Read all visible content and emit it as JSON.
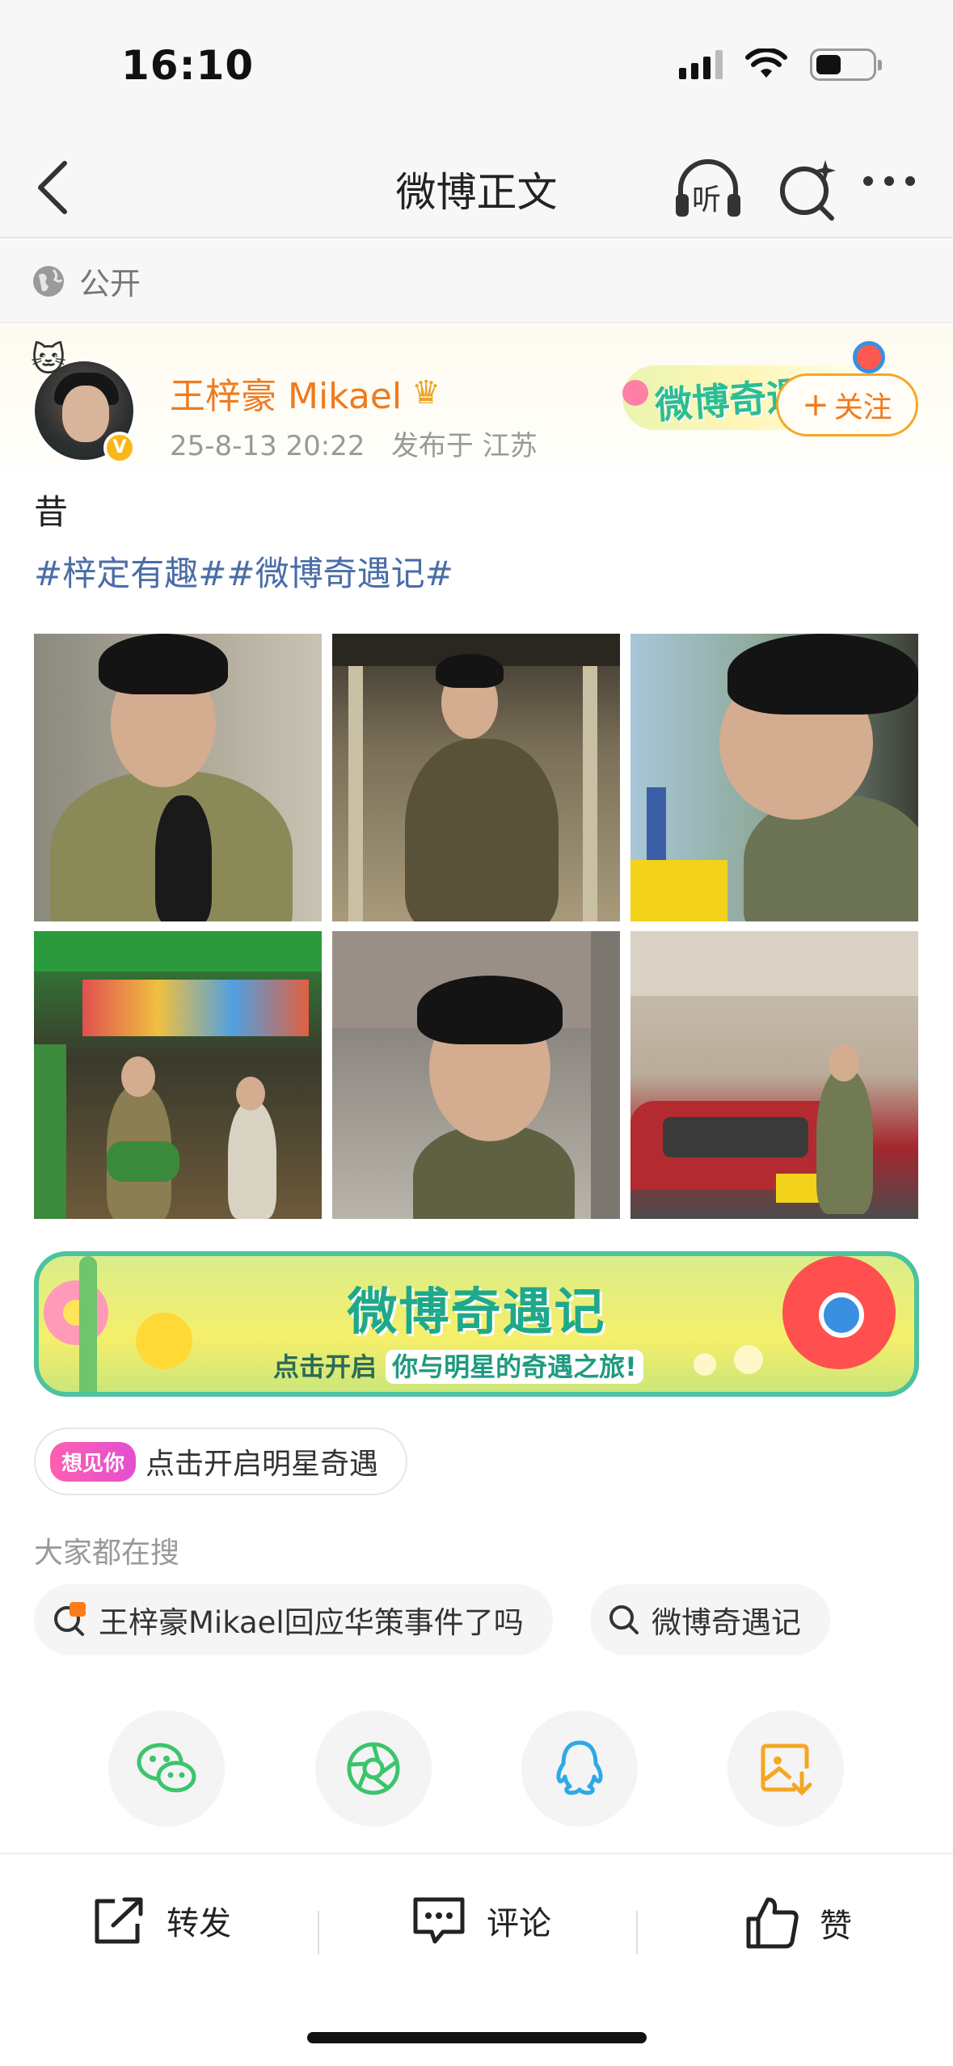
{
  "status_bar": {
    "time": "16:10"
  },
  "nav": {
    "title": "微博正文",
    "listen_label": "听"
  },
  "visibility": {
    "label": "公开"
  },
  "post": {
    "author": "王梓豪 Mikael",
    "timestamp": "25-8-13 20:22",
    "location": "发布于 江苏",
    "follow_label": "+关注",
    "follow_plus": "+",
    "follow_text": "关注",
    "text": "昔",
    "hashtags": "#梓定有趣##微博奇遇记#",
    "badge_logo": "微博奇遇记",
    "image_count": 6
  },
  "promo": {
    "title": "微博奇遇记",
    "subtitle_prefix": "点击开启",
    "subtitle_highlight": "你与明星的奇遇之旅!"
  },
  "chip": {
    "pill": "想见你",
    "label": "点击开启明星奇遇"
  },
  "hot_search": {
    "label": "大家都在搜",
    "items": [
      {
        "text": "王梓豪Mikael回应华策事件了吗",
        "icon": "hot-search-icon"
      },
      {
        "text": "微博奇遇记",
        "icon": "search-icon"
      }
    ]
  },
  "share": {
    "targets": [
      {
        "name": "wechat",
        "color": "#3cc46c"
      },
      {
        "name": "moments",
        "color": "#3cc46c"
      },
      {
        "name": "qq",
        "color": "#2ea9e6"
      },
      {
        "name": "save-image",
        "color": "#f5a623"
      }
    ]
  },
  "actions": {
    "repost": "转发",
    "comment": "评论",
    "like": "赞"
  },
  "colors": {
    "accent": "#f07a1f",
    "link": "#4a6da7",
    "promo_green": "#1ea98a"
  }
}
